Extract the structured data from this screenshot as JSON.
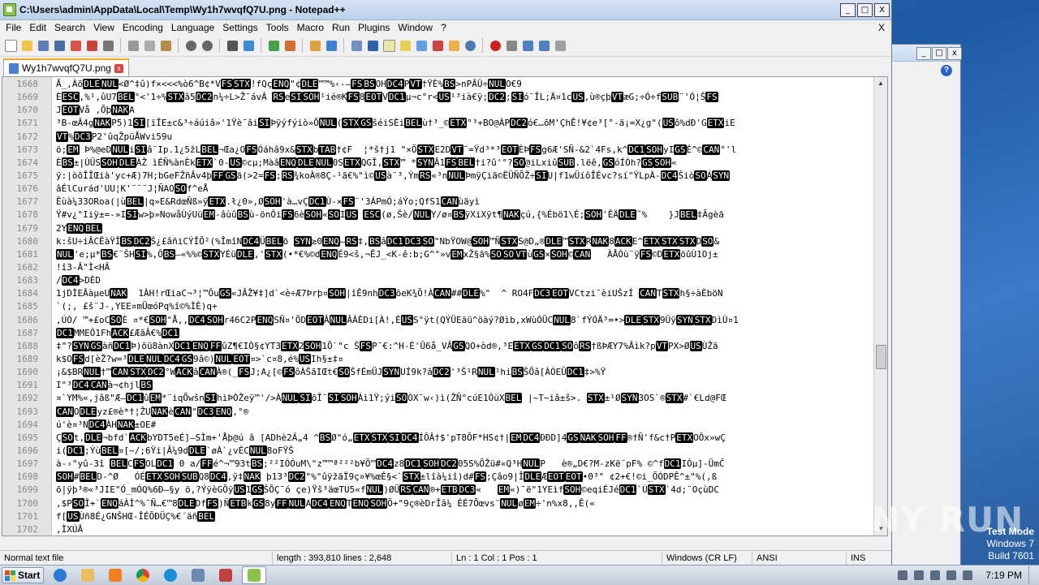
{
  "window": {
    "title": "C:\\Users\\admin\\AppData\\Local\\Temp\\Wy1h7wvqfQ7U.png - Notepad++",
    "min": "_",
    "max": "□",
    "close": "X"
  },
  "menu": [
    "File",
    "Edit",
    "Search",
    "View",
    "Encoding",
    "Language",
    "Settings",
    "Tools",
    "Macro",
    "Run",
    "Plugins",
    "Window",
    "?"
  ],
  "menu_close": "X",
  "tab": {
    "label": "Wy1h7wvqfQ7U.png",
    "close": "x"
  },
  "lines": [
    {
      "n": "1668",
      "t": "Â_,ÀõDLENUL<Ø^‡û)f×<<<%ò6^B¢*VFSSTX!fQçENQ\"¢DLE™™%‹-–FSBSOHDC4PVT†ŸÈ%BS>nPÂÛ÷NULO€9"
    },
    {
      "n": "1669",
      "t": "ÈESC,%¹,ûU7BEL°<'1÷%STXâ5DC2n¼÷L>Ž¯ávÁ RSeSISOH¹ié®KFS8EOTVDC1µ¬c°r<US¹³ià€ÿ;DC2;SIó¨ÎL;Ä¤1cUS,ù®çþVTæG;÷Ó÷fSUB¨'Ó¦ŠFS"
    },
    {
      "n": "1670",
      "t": "JEOTVå ,ÕþNAKA"
    },
    {
      "n": "1671",
      "t": "³B-œÂ4gNAKP5)1SI[ïÎE±c&³÷áúiâ»'1Ÿè¯âiSIÞÿýfýiò»ÕNUL(STXGSšéiSÈiBELù†³_©ETX°³+BO@ÀPDC2ó€…õM'ÇhÊ!¥¢e³[°-ä¡=X¿g\"(USô%dÐ'GETXiE"
    },
    {
      "n": "1672",
      "t": "VT%DC3P2'ûqŽpüÅWvi59u"
    },
    {
      "n": "1673",
      "t": "ö;EM Þ%@eDNULiSIâ¨Ip.1¿5žLBEL¬Œa¿OFSÓáhâ9x&STXbTAB†¢F  ¦*š†j1 \"×ÖSTXE2DVT¯=Ÿd³*³EOTÈÞFSg6Æ'SÑ-&2`4Fs,k^DC1SOHyIGSÉ^©CAN°'l"
    },
    {
      "n": "1674",
      "t": "ÈBS±|ÙÜSSOHDLEÀŽ ìÉÑ%ànÈkETX`0-US©cµ;MàâENQDLENUL0SETXQGÎ,STX™ *SYNÂ1FSBEL†i?û'°?SO@iLxiûSUB.lëê,GSóÍÓh?GSSOH«"
    },
    {
      "n": "1675",
      "t": "ÿ:|òõÎÎŒià'yc+Æ)7H;bGeFŽñÂv4þFFGSã(>2=FS;RS¾koÀ®8Ç-¹ã€%\"ì©USà¨³,ÝmRS«³nNULÞmÿÇiã©ËÜÑÕŽ÷SIU|f1wÜíôÎÉvc?sí\"ŸLpÀ-DC4ŠiòSOÁSYN"
    },
    {
      "n": "1676",
      "t": "âÉlCurád'UU¦K'¨¨¨J¦ÑAOSOf^eÅ"
    },
    {
      "n": "1677",
      "t": "Êùà¼33ORoa(|ùBEL|q»E&RdœÑß»ÿETX.ł¿0»,ØSOH'à…vÇDC1Ù-×FS¨'3ÁPmÓ;áÝo;QfS1CANùäyì"
    },
    {
      "n": "1678",
      "t": "Ÿ#v¿°Iiÿ±=-»ISIw>þ»NowåÙýUüEM-âùûBSù-önÔiFS6èSOH«SOIUS ESC(ø,Šè/NULY/ø¤BSÿXiXÿt¶NAKçú,{%Ébö1\\É;SOH'ÊÄDLE˜%    }JBEL‡Ãgèã"
    },
    {
      "n": "1679",
      "t": "2YENQBEL"
    },
    {
      "n": "1680",
      "t": "k:šU÷iÂCÊàŸÎBSDC2Š¿£âñiCÝÎÕ²(%ÎmîNDC4ÜBELö SYN≥0ENQ–RS‡,BSâDC1DC3SO\"NbŸOW@SOH™ÑSTXS@D„®DLE™STXRNAK8ACKE^ETXSTXSTXDSO&"
    },
    {
      "n": "1681",
      "t": "NUL'e;µ*BS€¨ŠHSI%,ÔBS–«%%©STXYÉüDLE,'STX(•*€%©dENQÉ9<š,¬ÊJ_<K-ê:b;G^°»vEMxŽ§ã%SOSOVTùGS×SOH©CAN   ÀÅÓù¨ÿFS©DETXöûÙ1Oj±"
    },
    {
      "n": "1682",
      "t": "!î3-Â\"Ì<HÂ"
    },
    {
      "n": "1683",
      "t": "/DC4>DÈD"
    },
    {
      "n": "1684",
      "t": "1jDÌEÂàµeUNAK  1ÀH!rŒiaC¬³¦™ÔuGS«JÂŽ¥‡]d`<è÷Æ7Þrþ¤SOH|îÊ9nhDC3õeK¾Õ!ÀCAN##DLE%\"  ^ RO4FDC3EOTVCtzi¯èiUŠzÍ CANTSTXh§÷àÈböN"
    },
    {
      "n": "1685",
      "t": "`(;, £š¨J-,YEE¤mÜœóPq%î©%ÌÈ)q+"
    },
    {
      "n": "1686",
      "t": ",ÚÓ/ ™+£oCSOÈ ¤*€SOH°Å,,DC4SOHr46C2PENQSÑ¤'ÕDEOTÂNULÂÀÈDi[À!,ÈUSS°ÿt(QÝÜEäü^öàý?Øìb,xWùÓÜCNUL8`fÝÓÄ³=•>DLESTX9ÜÿSYNSTXDìÙ¤1"
    },
    {
      "n": "1687",
      "t": "DC1MMEÔ1FhACK£ÆãÂ€%DC1"
    },
    {
      "n": "1688",
      "t": "‡\"?SYNGSàñDC1Þ)õü8ànXDC1ENQFFûZ¶€IÒ§¢YT3ETX2SOH1Õ`\"c ŠFSP¯€:^H-È'Û6å_VÂGSQO+òd®,³EETXGSDC1SOôRS†ßÞÆY7%Âìk?pVTPX>ØUSÙŽã"
    },
    {
      "n": "1689",
      "t": "k$OFSd[èŽ?w=³DLENULDC4GS9â©)NULEOT¤>`c¤8,é%USIh§±‡¤"
    },
    {
      "n": "1690",
      "t": "¡&$BRNUL†™CANSTXDC2°WACKâCANÀ®(_FSJ;A¿[©FSôÀŠãIŒt€SOŠfÉmÜJSYNUÍ9k?âDC2'³Š¹RNUL¹hiBSŠÕâ[ÀÓEÜDC1‡>%Ÿ"
    },
    {
      "n": "1691",
      "t": "I°³DC4CANà¬¢hjlBS"
    },
    {
      "n": "1692",
      "t": "¤`YM%«,jâß\"Æ–DC1ûEM*¨iqÕwšnSIhìÞÒŽeÿ™'/>ÀNULSIõÎ¨SISOHÀì1Ÿ;ýiSOÒX¯w‹)ì(ŽÑ°cúE1ÓùXBEL |~T~iâ±š>. STX±¹ØSYN3OS`®STX#`€Ld@FŒ"
    },
    {
      "n": "1693",
      "t": "CANODLEyz£®è*†¦ŽUNAKèCAN\"DC3ENQ,°®"
    },
    {
      "n": "1694",
      "t": "ú'è¤³NDC4ÀHNAK±OE#"
    },
    {
      "n": "1695",
      "t": "ÇSOt,DLE¬bfd`ACKbYDT5eÉ]–SÌm+'Åþ@ú â [ADhè2Á„4 ^BSØ\"ó„ETXSTXSIDC4ÍÔÂ†$'pT8ÕF*HS¢†|EMDC4ÐÐD]4GSNAKSOHFF®†Ñ'f&c†PETXOÔx»wÇ"
    },
    {
      "n": "1696",
      "t": "i(DC1;ÝùBEL¤[~/;6Ÿi|Â¼9dDLE`øÀ`¿vÉCNUL8oFŸŠ"
    },
    {
      "n": "1697",
      "t": "à-›\"yû-3î BELCFSOLDC1 0 a/FFé^¬™93tBS;²²IÓÓuM\\\"z™™ª²²²b¥Ö™DC4z8DC1SOHDC205S%ÕŽü#«Q³HNULP   è®„D€?M-zKë¨pF% ©^fDC1IÒµ]-ÜmĈ"
    },
    {
      "n": "1698",
      "t": "SOH#BELD-^Ø   ÓÉETXSOHSUBQ8DC4,ÿ‡NAK þ13³DC2\"%\"ûÿžãÏ9ç¤¥%œÉ§<`STX±lîà¼iî)d#FS;Çâo9|ÎDLEÆEOTEOT•0³\" ¢2+€!©i_ÕÓDPÊ^±\"%(,ß"
    },
    {
      "n": "1699",
      "t": "õ|ÿþ³®«³JIE\"Ó_mÓQ%6Ð–§y ö,?ÝÿèGÕÿUS1GSŠÕÇ¯ó çe)Ÿš³äœTU5«fNUL)ØÜRSCAN®+ETBDC3«   EM«)¯ë\"1YEìfSOH©eqiÉJéDC1`ÙSTX`4d;¨OçùDC"
    },
    {
      "n": "1700",
      "t": ",$PSOÎ+`ENQáÀÌ^%¯Ñ…€™8DLEDfFS)ÑETBkGS8yFFNULADC4ENQTENQSOHÖ+\"9ç®èDrÎâ¼ ÉÉ7Õœvs¨NULøEM÷'n%x8,,Ê(«"
    },
    {
      "n": "1701",
      "t": "f[USÙñ8É¿GNŠHŒ-ÎÉÕÐÜÇ%€´äñBEL"
    },
    {
      "n": "1702",
      "t": ",ÌXÚÂ"
    }
  ],
  "controls": [
    "NUL",
    "SOH",
    "STX",
    "ETX",
    "EOT",
    "ENQ",
    "ACK",
    "BEL",
    "BS",
    "VT",
    "FF",
    "SO",
    "SI",
    "DLE",
    "DC1",
    "DC2",
    "DC3",
    "DC4",
    "NAK",
    "SYN",
    "ETB",
    "CAN",
    "EM",
    "SUB",
    "ESC",
    "FS",
    "GS",
    "RS",
    "US",
    "TAB"
  ],
  "status": {
    "type": "Normal text file",
    "length": "length : 393,810    lines : 2,648",
    "pos": "Ln : 1    Col : 1    Pos : 1",
    "eol": "Windows (CR LF)",
    "enc": "ANSI",
    "ins": "INS"
  },
  "watermark": "ANY RUN",
  "testmode": [
    "Test Mode",
    "Windows 7",
    "Build 7601"
  ],
  "taskbar": {
    "start": "Start",
    "clock": "7:19 PM"
  },
  "colors": {
    "accent": "#f9a825",
    "desktop": "#2b68b3"
  }
}
